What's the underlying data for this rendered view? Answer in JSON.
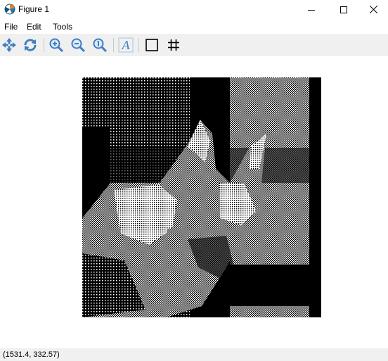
{
  "window": {
    "title": "Figure 1",
    "icon": "matplotlib-icon",
    "controls": [
      "minimize-icon",
      "maximize-icon",
      "close-icon"
    ]
  },
  "menu": {
    "items": [
      {
        "label": "File"
      },
      {
        "label": "Edit"
      },
      {
        "label": "Tools"
      }
    ]
  },
  "toolbar": {
    "buttons": [
      {
        "icon": "pan-icon"
      },
      {
        "icon": "refresh-icon"
      },
      {
        "icon": "zoom-in-icon"
      },
      {
        "icon": "zoom-out-icon"
      },
      {
        "icon": "zoom-reset-icon"
      },
      {
        "icon": "text-icon",
        "glyph": "A"
      },
      {
        "icon": "rectangle-icon"
      },
      {
        "icon": "grid-icon"
      }
    ]
  },
  "canvas": {
    "image_description_colors": {
      "dark": "#000000",
      "light": "#ffffff",
      "gray": "#8c8c8c"
    }
  },
  "status": {
    "coordinates": "(1531.4, 332.57)"
  }
}
